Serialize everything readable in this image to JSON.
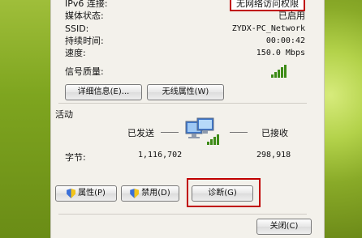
{
  "connection": {
    "ipv6_label": "IPv6 连接:",
    "ipv6_value": "无网络访问权限",
    "media_label": "媒体状态:",
    "media_value": "已启用",
    "ssid_label": "SSID:",
    "ssid_value": "ZYDX-PC_Network",
    "duration_label": "持续时间:",
    "duration_value": "00:00:42",
    "speed_label": "速度:",
    "speed_value": "150.0 Mbps",
    "signal_label": "信号质量:"
  },
  "buttons": {
    "details": "详细信息(E)...",
    "wireless_props": "无线属性(W)",
    "properties": "属性(P)",
    "disable": "禁用(D)",
    "diagnose": "诊断(G)",
    "close": "关闭(C)"
  },
  "activity": {
    "title": "活动",
    "sent_label": "已发送",
    "received_label": "已接收",
    "bytes_label": "字节:",
    "bytes_sent": "1,116,702",
    "bytes_received": "298,918"
  },
  "colors": {
    "highlight": "#c00000",
    "signal": "#3d8b17"
  }
}
